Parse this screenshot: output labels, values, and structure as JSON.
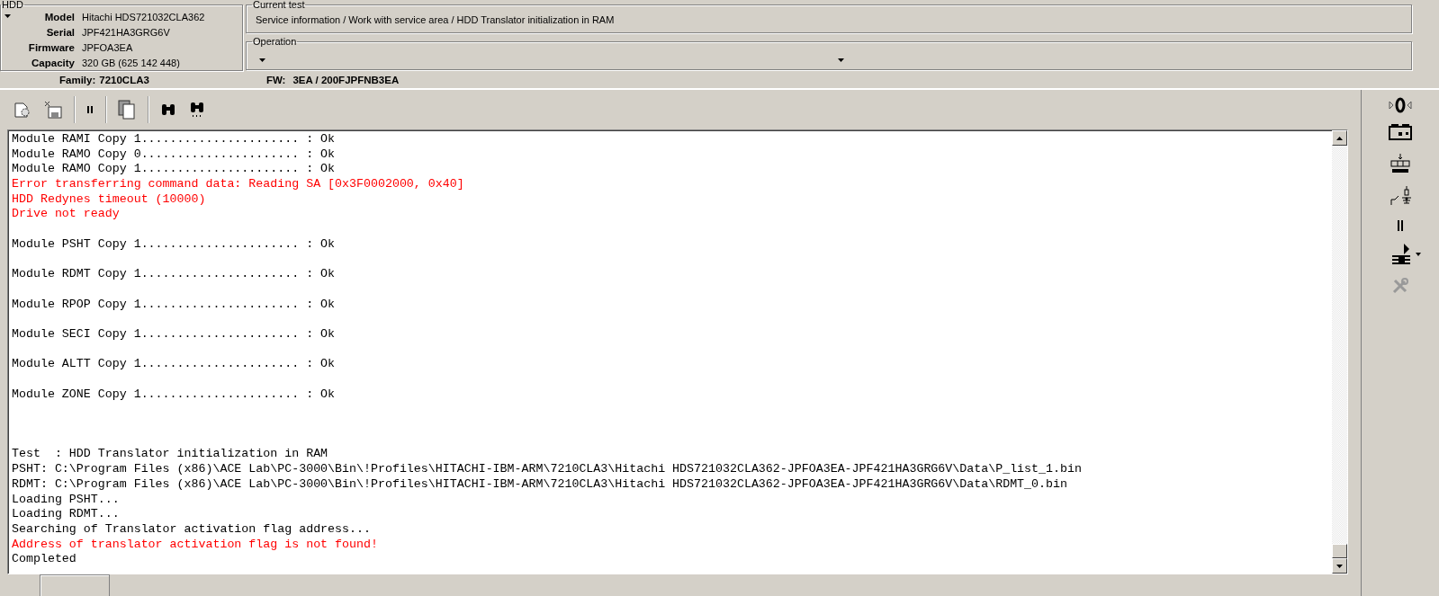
{
  "hdd": {
    "title": "HDD",
    "fields": [
      {
        "label": "Model",
        "value": "Hitachi HDS721032CLA362"
      },
      {
        "label": "Serial",
        "value": "JPF421HA3GRG6V"
      },
      {
        "label": "Firmware",
        "value": "JPFOA3EA"
      },
      {
        "label": "Capacity",
        "value": "320 GB (625 142 448)"
      }
    ]
  },
  "current_test": {
    "title": "Current test",
    "value": "Service information / Work with service area / HDD Translator initialization in RAM"
  },
  "operation": {
    "title": "Operation"
  },
  "info": [
    {
      "label": "Family:",
      "value": "7210CLA3"
    },
    {
      "label": "FW:",
      "value": "3EA / 200FJPFNB3EA"
    }
  ],
  "log": [
    {
      "kind": "ok",
      "text": "Module RAMI Copy 1...................... : Ok"
    },
    {
      "kind": "ok",
      "text": "Module RAMO Copy 0...................... : Ok"
    },
    {
      "kind": "ok",
      "text": "Module RAMO Copy 1...................... : Ok"
    },
    {
      "kind": "error",
      "text": "Error transferring command data: Reading SA [0x3F0002000, 0x40]"
    },
    {
      "kind": "error",
      "text": "HDD Redynes timeout (10000)"
    },
    {
      "kind": "error",
      "text": "Drive not ready"
    },
    {
      "kind": "blank"
    },
    {
      "kind": "ok",
      "text": "Module PSHT Copy 1...................... : Ok"
    },
    {
      "kind": "blank"
    },
    {
      "kind": "ok",
      "text": "Module RDMT Copy 1...................... : Ok"
    },
    {
      "kind": "blank"
    },
    {
      "kind": "ok",
      "text": "Module RPOP Copy 1...................... : Ok"
    },
    {
      "kind": "blank"
    },
    {
      "kind": "ok",
      "text": "Module SECI Copy 1...................... : Ok"
    },
    {
      "kind": "blank"
    },
    {
      "kind": "ok",
      "text": "Module ALTT Copy 1...................... : Ok"
    },
    {
      "kind": "blank"
    },
    {
      "kind": "ok",
      "text": "Module ZONE Copy 1...................... : Ok"
    },
    {
      "kind": "blank"
    },
    {
      "kind": "blank"
    },
    {
      "kind": "blank"
    },
    {
      "kind": "ok",
      "text": "Test  : HDD Translator initialization in RAM"
    },
    {
      "kind": "ok",
      "text": "PSHT: C:\\Program Files (x86)\\ACE Lab\\PC-3000\\Bin\\!Profiles\\HITACHI-IBM-ARM\\7210CLA3\\Hitachi HDS721032CLA362-JPFOA3EA-JPF421HA3GRG6V\\Data\\P_list_1.bin"
    },
    {
      "kind": "ok",
      "text": "RDMT: C:\\Program Files (x86)\\ACE Lab\\PC-3000\\Bin\\!Profiles\\HITACHI-IBM-ARM\\7210CLA3\\Hitachi HDS721032CLA362-JPFOA3EA-JPF421HA3GRG6V\\Data\\RDMT_0.bin"
    },
    {
      "kind": "ok",
      "text": "Loading PSHT..."
    },
    {
      "kind": "ok",
      "text": "Loading RDMT..."
    },
    {
      "kind": "ok",
      "text": "Searching of Translator activation flag address..."
    },
    {
      "kind": "error",
      "text": "Address of translator activation flag is not found!"
    },
    {
      "kind": "ok",
      "text": "Completed"
    }
  ]
}
